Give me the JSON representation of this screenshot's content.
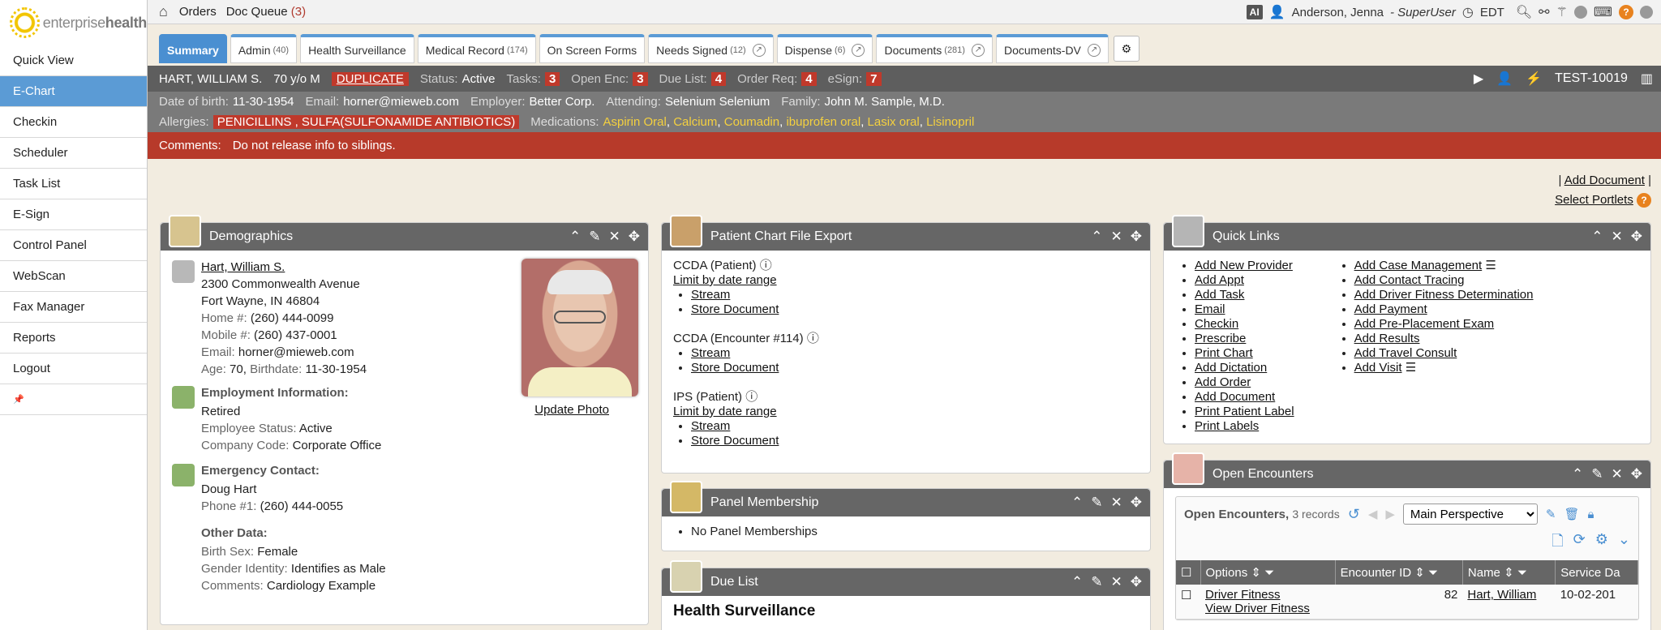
{
  "brand": {
    "light": "enterprise",
    "bold": "health"
  },
  "sidebar": {
    "items": [
      {
        "label": "Quick View"
      },
      {
        "label": "E-Chart"
      },
      {
        "label": "Checkin"
      },
      {
        "label": "Scheduler"
      },
      {
        "label": "Task List"
      },
      {
        "label": "E-Sign"
      },
      {
        "label": "Control Panel"
      },
      {
        "label": "WebScan"
      },
      {
        "label": "Fax Manager"
      },
      {
        "label": "Reports"
      },
      {
        "label": "Logout"
      }
    ],
    "pin": "📌"
  },
  "topbar": {
    "orders": "Orders",
    "doc_queue": "Doc Queue",
    "doc_queue_count": "(3)",
    "ai": "AI",
    "user": "Anderson, Jenna",
    "role": "- SuperUser",
    "timezone": "EDT"
  },
  "tabs": [
    {
      "label": "Summary",
      "count": ""
    },
    {
      "label": "Admin",
      "count": "(40)"
    },
    {
      "label": "Health Surveillance",
      "count": ""
    },
    {
      "label": "Medical Record",
      "count": "(174)"
    },
    {
      "label": "On Screen Forms",
      "count": ""
    },
    {
      "label": "Needs Signed",
      "count": "(12)"
    },
    {
      "label": "Dispense",
      "count": "(6)"
    },
    {
      "label": "Documents",
      "count": "(281)"
    },
    {
      "label": "Documents-DV",
      "count": ""
    }
  ],
  "patient": {
    "name": "HART, WILLIAM S.",
    "age_sex": "70 y/o M",
    "duplicate": "DUPLICATE",
    "status_label": "Status:",
    "status": "Active",
    "tasks_label": "Tasks:",
    "tasks": "3",
    "open_enc_label": "Open Enc:",
    "open_enc": "3",
    "due_list_label": "Due List:",
    "due_list": "4",
    "order_req_label": "Order Req:",
    "order_req": "4",
    "esign_label": "eSign:",
    "esign": "7",
    "record_id": "TEST-10019",
    "dob_label": "Date of birth:",
    "dob": "11-30-1954",
    "email_label": "Email:",
    "email": "horner@mieweb.com",
    "employer_label": "Employer:",
    "employer": "Better Corp.",
    "attending_label": "Attending:",
    "attending": "Selenium Selenium",
    "family_label": "Family:",
    "family": "John M. Sample, M.D.",
    "allergies_label": "Allergies:",
    "allergies": "PENICILLINS , SULFA(SULFONAMIDE ANTIBIOTICS)",
    "medications_label": "Medications:",
    "medications": [
      "Aspirin Oral",
      "Calcium",
      "Coumadin",
      "ibuprofen oral",
      "Lasix oral",
      "Lisinopril"
    ],
    "comments_label": "Comments:",
    "comments": "Do not release info to siblings."
  },
  "doc_links": {
    "add_document": "Add Document",
    "select_portlets": "Select Portlets"
  },
  "demographics": {
    "title": "Demographics",
    "name": "Hart, William S.",
    "address1": "2300 Commonwealth Avenue",
    "address2": "Fort Wayne, IN 46804",
    "home_label": "Home #:",
    "home": "(260) 444-0099",
    "mobile_label": "Mobile #:",
    "mobile": "(260) 437-0001",
    "email_label": "Email:",
    "email": "horner@mieweb.com",
    "age_label": "Age:",
    "age": "70,",
    "birthdate_label": "Birthdate:",
    "birthdate": "11-30-1954",
    "update_photo": "Update Photo",
    "employment_heading": "Employment Information:",
    "employment_status_text": "Retired",
    "employee_status_label": "Employee Status:",
    "employee_status": "Active",
    "company_code_label": "Company Code:",
    "company_code": "Corporate Office",
    "emergency_heading": "Emergency Contact:",
    "emergency_name": "Doug Hart",
    "phone1_label": "Phone #1:",
    "phone1": "(260) 444-0055",
    "other_heading": "Other Data:",
    "birth_sex_label": "Birth Sex:",
    "birth_sex": "Female",
    "gender_label": "Gender Identity:",
    "gender": "Identifies as Male",
    "comments_label": "Comments:",
    "comments": "Cardiology Example"
  },
  "export": {
    "title": "Patient Chart File Export",
    "ccda_patient": "CCDA (Patient)",
    "limit1": "Limit by date range",
    "stream": "Stream",
    "store": "Store Document",
    "ccda_encounter": "CCDA (Encounter #114)",
    "ips_patient": "IPS (Patient)",
    "limit2": "Limit by date range"
  },
  "panel": {
    "title": "Panel Membership",
    "item": "No Panel Memberships"
  },
  "due_list": {
    "title": "Due List",
    "heading": "Health Surveillance"
  },
  "quick_links": {
    "title": "Quick Links",
    "col1": [
      "Add New Provider",
      "Add Appt",
      "Add Task",
      "Email",
      "Checkin",
      "Prescribe",
      "Print Chart",
      "Add Dictation",
      "Add Order",
      "Add Document",
      "Print Patient Label",
      "Print Labels"
    ],
    "col2": [
      "Add Case Management",
      "Add Contact Tracing",
      "Add Driver Fitness Determination",
      "Add Payment",
      "Add Pre-Placement Exam",
      "Add Results",
      "Add Travel Consult",
      "Add Visit"
    ]
  },
  "open_encounters": {
    "title": "Open Encounters",
    "subtitle": "Open Encounters,",
    "records": "3 records",
    "perspective": "Main Perspective",
    "columns": [
      "Options",
      "Encounter ID",
      "Name",
      "Service Da"
    ],
    "rows": [
      {
        "option1": "Driver Fitness",
        "option2": "View Driver Fitness",
        "id": "82",
        "name": "Hart, William",
        "date": "10-02-201"
      }
    ]
  }
}
